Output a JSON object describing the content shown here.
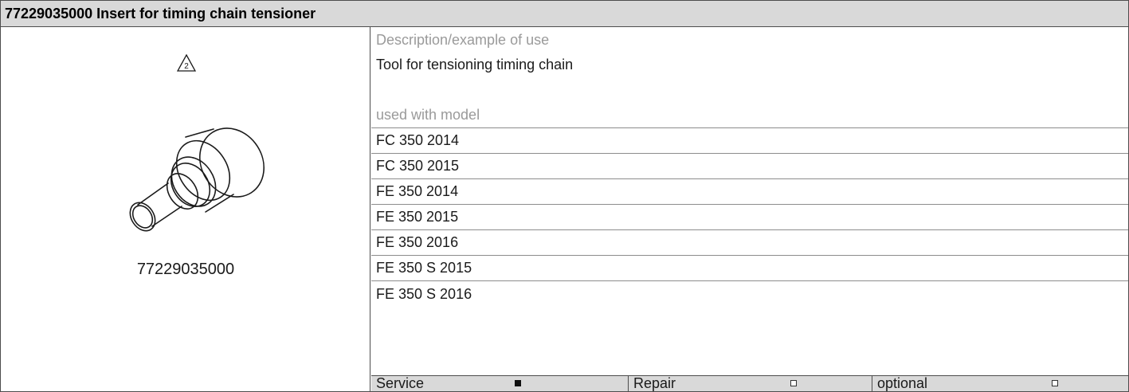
{
  "title": "77229035000 Insert for timing chain tensioner",
  "left": {
    "warning_icon_label": "2",
    "part_number": "77229035000"
  },
  "description": {
    "heading": "Description/example of use",
    "text": "Tool for tensioning timing chain"
  },
  "models": {
    "heading": "used with model",
    "items": [
      "FC 350 2014",
      "FC 350 2015",
      "FE 350 2014",
      "FE 350 2015",
      "FE 350 2016",
      "FE 350 S 2015",
      "FE 350 S 2016"
    ]
  },
  "footer": {
    "service_label": "Service",
    "service_checked": true,
    "repair_label": "Repair",
    "repair_checked": false,
    "optional_label": "optional",
    "optional_checked": false
  }
}
